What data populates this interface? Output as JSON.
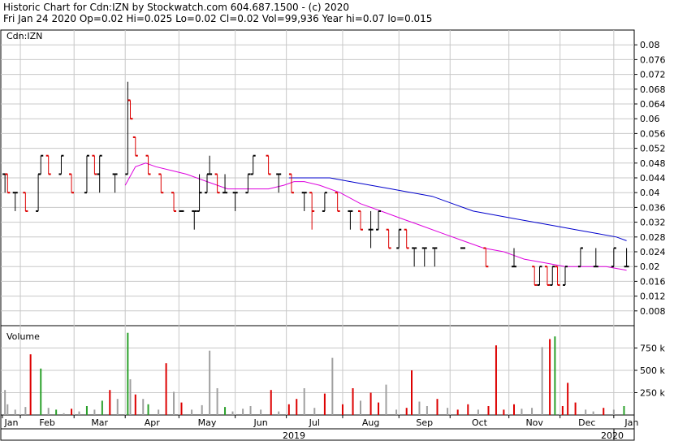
{
  "header": {
    "line1": "Historic Chart for Cdn:IZN by Stockwatch.com 604.687.1500 - (c) 2020",
    "line2": "Fri Jan 24 2020  Op=0.02  Hi=0.025  Lo=0.02  Cl=0.02  Vol=99,936  Year hi=0.07  lo=0.015"
  },
  "chart_data": {
    "type": "line",
    "symbol_label": "Cdn:IZN",
    "volume_label": "Volume",
    "price_ylim": [
      0.004,
      0.084
    ],
    "price_ticks": [
      "0.08",
      "0.076",
      "0.072",
      "0.068",
      "0.064",
      "0.06",
      "0.056",
      "0.052",
      "0.048",
      "0.044",
      "0.04",
      "0.036",
      "0.032",
      "0.028",
      "0.024",
      "0.02",
      "0.016",
      "0.012",
      "0.008"
    ],
    "volume_ylim": [
      0,
      1000000
    ],
    "volume_ticks": [
      {
        "label": "750 k",
        "value": 750000
      },
      {
        "label": "500 k",
        "value": 500000
      },
      {
        "label": "250 k",
        "value": 250000
      }
    ],
    "months": [
      {
        "label": "Jan",
        "day": 0
      },
      {
        "label": "Feb",
        "day": 7
      },
      {
        "label": "Mar",
        "day": 28
      },
      {
        "label": "Apr",
        "day": 48
      },
      {
        "label": "May",
        "day": 69
      },
      {
        "label": "Jun",
        "day": 91
      },
      {
        "label": "Jul",
        "day": 111
      },
      {
        "label": "Aug",
        "day": 133
      },
      {
        "label": "Sep",
        "day": 155
      },
      {
        "label": "Oct",
        "day": 175
      },
      {
        "label": "Nov",
        "day": 198
      },
      {
        "label": "Dec",
        "day": 218
      },
      {
        "label": "Jan",
        "day": 239
      }
    ],
    "years": [
      {
        "label": "2019"
      },
      {
        "label": "2020"
      }
    ],
    "colors": {
      "up": "#000000",
      "down": "#dd0000",
      "ma_short": "#dd00dd",
      "ma_long": "#0000cc",
      "vol_up": "#2aa02a",
      "vol_down": "#dd0000",
      "vol_neutral": "#a0a0a0",
      "grid": "#c8c8c8"
    },
    "ma_short": [
      [
        48,
        0.042
      ],
      [
        52,
        0.047
      ],
      [
        56,
        0.048
      ],
      [
        60,
        0.047
      ],
      [
        66,
        0.046
      ],
      [
        72,
        0.045
      ],
      [
        80,
        0.043
      ],
      [
        88,
        0.041
      ],
      [
        96,
        0.041
      ],
      [
        104,
        0.041
      ],
      [
        110,
        0.042
      ],
      [
        114,
        0.043
      ],
      [
        118,
        0.043
      ],
      [
        124,
        0.042
      ],
      [
        132,
        0.04
      ],
      [
        140,
        0.037
      ],
      [
        148,
        0.035
      ],
      [
        156,
        0.033
      ],
      [
        164,
        0.031
      ],
      [
        172,
        0.029
      ],
      [
        180,
        0.027
      ],
      [
        188,
        0.025
      ],
      [
        196,
        0.024
      ],
      [
        204,
        0.022
      ],
      [
        212,
        0.021
      ],
      [
        220,
        0.02
      ],
      [
        228,
        0.02
      ],
      [
        236,
        0.02
      ],
      [
        244,
        0.019
      ]
    ],
    "ma_long": [
      [
        112,
        0.044
      ],
      [
        120,
        0.044
      ],
      [
        128,
        0.044
      ],
      [
        136,
        0.043
      ],
      [
        144,
        0.042
      ],
      [
        152,
        0.041
      ],
      [
        160,
        0.04
      ],
      [
        168,
        0.039
      ],
      [
        176,
        0.037
      ],
      [
        184,
        0.035
      ],
      [
        192,
        0.034
      ],
      [
        200,
        0.033
      ],
      [
        208,
        0.032
      ],
      [
        216,
        0.031
      ],
      [
        224,
        0.03
      ],
      [
        232,
        0.029
      ],
      [
        240,
        0.028
      ],
      [
        244,
        0.027
      ]
    ],
    "ohlc": [
      {
        "d": 1,
        "o": 0.045,
        "h": 0.045,
        "l": 0.04,
        "c": 0.045
      },
      {
        "d": 2,
        "o": 0.045,
        "h": 0.045,
        "l": 0.04,
        "c": 0.04
      },
      {
        "d": 5,
        "o": 0.04,
        "h": 0.04,
        "l": 0.035,
        "c": 0.04
      },
      {
        "d": 9,
        "o": 0.04,
        "h": 0.04,
        "l": 0.035,
        "c": 0.035
      },
      {
        "d": 14,
        "o": 0.035,
        "h": 0.045,
        "l": 0.035,
        "c": 0.045
      },
      {
        "d": 15,
        "o": 0.045,
        "h": 0.05,
        "l": 0.045,
        "c": 0.05
      },
      {
        "d": 18,
        "o": 0.05,
        "h": 0.05,
        "l": 0.045,
        "c": 0.045
      },
      {
        "d": 23,
        "o": 0.045,
        "h": 0.05,
        "l": 0.045,
        "c": 0.05
      },
      {
        "d": 27,
        "o": 0.045,
        "h": 0.045,
        "l": 0.04,
        "c": 0.04
      },
      {
        "d": 33,
        "o": 0.04,
        "h": 0.05,
        "l": 0.04,
        "c": 0.05
      },
      {
        "d": 36,
        "o": 0.05,
        "h": 0.05,
        "l": 0.045,
        "c": 0.045
      },
      {
        "d": 38,
        "o": 0.045,
        "h": 0.05,
        "l": 0.04,
        "c": 0.05
      },
      {
        "d": 44,
        "o": 0.045,
        "h": 0.045,
        "l": 0.04,
        "c": 0.045
      },
      {
        "d": 49,
        "o": 0.045,
        "h": 0.07,
        "l": 0.045,
        "c": 0.065
      },
      {
        "d": 50,
        "o": 0.065,
        "h": 0.065,
        "l": 0.06,
        "c": 0.06
      },
      {
        "d": 52,
        "o": 0.055,
        "h": 0.055,
        "l": 0.05,
        "c": 0.05
      },
      {
        "d": 57,
        "o": 0.05,
        "h": 0.05,
        "l": 0.045,
        "c": 0.045
      },
      {
        "d": 62,
        "o": 0.045,
        "h": 0.045,
        "l": 0.04,
        "c": 0.04
      },
      {
        "d": 67,
        "o": 0.04,
        "h": 0.04,
        "l": 0.035,
        "c": 0.035
      },
      {
        "d": 70,
        "o": 0.035,
        "h": 0.035,
        "l": 0.035,
        "c": 0.035
      },
      {
        "d": 75,
        "o": 0.035,
        "h": 0.035,
        "l": 0.03,
        "c": 0.035
      },
      {
        "d": 77,
        "o": 0.035,
        "h": 0.045,
        "l": 0.035,
        "c": 0.04
      },
      {
        "d": 80,
        "o": 0.04,
        "h": 0.045,
        "l": 0.04,
        "c": 0.045
      },
      {
        "d": 81,
        "o": 0.045,
        "h": 0.05,
        "l": 0.045,
        "c": 0.045
      },
      {
        "d": 84,
        "o": 0.045,
        "h": 0.045,
        "l": 0.04,
        "c": 0.04
      },
      {
        "d": 87,
        "o": 0.04,
        "h": 0.045,
        "l": 0.04,
        "c": 0.04
      },
      {
        "d": 91,
        "o": 0.04,
        "h": 0.04,
        "l": 0.035,
        "c": 0.04
      },
      {
        "d": 96,
        "o": 0.04,
        "h": 0.045,
        "l": 0.04,
        "c": 0.045
      },
      {
        "d": 98,
        "o": 0.045,
        "h": 0.05,
        "l": 0.045,
        "c": 0.05
      },
      {
        "d": 104,
        "o": 0.05,
        "h": 0.05,
        "l": 0.045,
        "c": 0.045
      },
      {
        "d": 108,
        "o": 0.045,
        "h": 0.045,
        "l": 0.04,
        "c": 0.045
      },
      {
        "d": 113,
        "o": 0.045,
        "h": 0.045,
        "l": 0.04,
        "c": 0.04
      },
      {
        "d": 118,
        "o": 0.04,
        "h": 0.04,
        "l": 0.035,
        "c": 0.04
      },
      {
        "d": 121,
        "o": 0.04,
        "h": 0.04,
        "l": 0.03,
        "c": 0.035
      },
      {
        "d": 126,
        "o": 0.035,
        "h": 0.04,
        "l": 0.035,
        "c": 0.04
      },
      {
        "d": 131,
        "o": 0.04,
        "h": 0.04,
        "l": 0.035,
        "c": 0.035
      },
      {
        "d": 136,
        "o": 0.035,
        "h": 0.035,
        "l": 0.03,
        "c": 0.035
      },
      {
        "d": 140,
        "o": 0.035,
        "h": 0.035,
        "l": 0.03,
        "c": 0.03
      },
      {
        "d": 144,
        "o": 0.03,
        "h": 0.035,
        "l": 0.025,
        "c": 0.03
      },
      {
        "d": 147,
        "o": 0.03,
        "h": 0.035,
        "l": 0.03,
        "c": 0.035
      },
      {
        "d": 151,
        "o": 0.03,
        "h": 0.03,
        "l": 0.025,
        "c": 0.025
      },
      {
        "d": 155,
        "o": 0.025,
        "h": 0.03,
        "l": 0.025,
        "c": 0.03
      },
      {
        "d": 158,
        "o": 0.03,
        "h": 0.03,
        "l": 0.025,
        "c": 0.025
      },
      {
        "d": 161,
        "o": 0.025,
        "h": 0.025,
        "l": 0.02,
        "c": 0.025
      },
      {
        "d": 165,
        "o": 0.025,
        "h": 0.025,
        "l": 0.02,
        "c": 0.025
      },
      {
        "d": 169,
        "o": 0.025,
        "h": 0.025,
        "l": 0.02,
        "c": 0.025
      },
      {
        "d": 180,
        "o": 0.025,
        "h": 0.025,
        "l": 0.025,
        "c": 0.025
      },
      {
        "d": 189,
        "o": 0.025,
        "h": 0.025,
        "l": 0.02,
        "c": 0.02
      },
      {
        "d": 200,
        "o": 0.02,
        "h": 0.025,
        "l": 0.02,
        "c": 0.02
      },
      {
        "d": 208,
        "o": 0.02,
        "h": 0.02,
        "l": 0.015,
        "c": 0.015
      },
      {
        "d": 210,
        "o": 0.015,
        "h": 0.02,
        "l": 0.015,
        "c": 0.02
      },
      {
        "d": 213,
        "o": 0.02,
        "h": 0.02,
        "l": 0.015,
        "c": 0.015
      },
      {
        "d": 215,
        "o": 0.015,
        "h": 0.02,
        "l": 0.015,
        "c": 0.02
      },
      {
        "d": 217,
        "o": 0.02,
        "h": 0.02,
        "l": 0.015,
        "c": 0.015
      },
      {
        "d": 220,
        "o": 0.015,
        "h": 0.02,
        "l": 0.015,
        "c": 0.02
      },
      {
        "d": 226,
        "o": 0.02,
        "h": 0.025,
        "l": 0.02,
        "c": 0.025
      },
      {
        "d": 232,
        "o": 0.02,
        "h": 0.025,
        "l": 0.02,
        "c": 0.02
      },
      {
        "d": 239,
        "o": 0.02,
        "h": 0.025,
        "l": 0.02,
        "c": 0.025
      },
      {
        "d": 244,
        "o": 0.02,
        "h": 0.025,
        "l": 0.02,
        "c": 0.02
      }
    ],
    "volume": [
      {
        "d": 1,
        "v": 280000,
        "c": "n"
      },
      {
        "d": 2,
        "v": 120000,
        "c": "n"
      },
      {
        "d": 5,
        "v": 60000,
        "c": "n"
      },
      {
        "d": 9,
        "v": 90000,
        "c": "n"
      },
      {
        "d": 11,
        "v": 680000,
        "c": "r"
      },
      {
        "d": 15,
        "v": 520000,
        "c": "g"
      },
      {
        "d": 18,
        "v": 80000,
        "c": "n"
      },
      {
        "d": 21,
        "v": 60000,
        "c": "g"
      },
      {
        "d": 24,
        "v": 20000,
        "c": "n"
      },
      {
        "d": 27,
        "v": 70000,
        "c": "r"
      },
      {
        "d": 30,
        "v": 40000,
        "c": "n"
      },
      {
        "d": 33,
        "v": 100000,
        "c": "g"
      },
      {
        "d": 36,
        "v": 60000,
        "c": "n"
      },
      {
        "d": 39,
        "v": 160000,
        "c": "g"
      },
      {
        "d": 42,
        "v": 280000,
        "c": "r"
      },
      {
        "d": 45,
        "v": 180000,
        "c": "n"
      },
      {
        "d": 49,
        "v": 920000,
        "c": "g"
      },
      {
        "d": 50,
        "v": 400000,
        "c": "n"
      },
      {
        "d": 52,
        "v": 230000,
        "c": "r"
      },
      {
        "d": 55,
        "v": 180000,
        "c": "n"
      },
      {
        "d": 57,
        "v": 120000,
        "c": "g"
      },
      {
        "d": 61,
        "v": 60000,
        "c": "n"
      },
      {
        "d": 64,
        "v": 580000,
        "c": "r"
      },
      {
        "d": 67,
        "v": 260000,
        "c": "n"
      },
      {
        "d": 70,
        "v": 140000,
        "c": "r"
      },
      {
        "d": 74,
        "v": 60000,
        "c": "n"
      },
      {
        "d": 78,
        "v": 110000,
        "c": "n"
      },
      {
        "d": 81,
        "v": 720000,
        "c": "n"
      },
      {
        "d": 84,
        "v": 300000,
        "c": "n"
      },
      {
        "d": 87,
        "v": 90000,
        "c": "g"
      },
      {
        "d": 90,
        "v": 40000,
        "c": "n"
      },
      {
        "d": 94,
        "v": 70000,
        "c": "n"
      },
      {
        "d": 97,
        "v": 100000,
        "c": "n"
      },
      {
        "d": 101,
        "v": 60000,
        "c": "n"
      },
      {
        "d": 105,
        "v": 280000,
        "c": "r"
      },
      {
        "d": 108,
        "v": 40000,
        "c": "n"
      },
      {
        "d": 112,
        "v": 120000,
        "c": "r"
      },
      {
        "d": 115,
        "v": 180000,
        "c": "r"
      },
      {
        "d": 118,
        "v": 300000,
        "c": "n"
      },
      {
        "d": 122,
        "v": 80000,
        "c": "n"
      },
      {
        "d": 126,
        "v": 240000,
        "c": "r"
      },
      {
        "d": 129,
        "v": 640000,
        "c": "n"
      },
      {
        "d": 133,
        "v": 120000,
        "c": "r"
      },
      {
        "d": 137,
        "v": 300000,
        "c": "r"
      },
      {
        "d": 140,
        "v": 160000,
        "c": "n"
      },
      {
        "d": 144,
        "v": 250000,
        "c": "r"
      },
      {
        "d": 147,
        "v": 140000,
        "c": "r"
      },
      {
        "d": 150,
        "v": 340000,
        "c": "n"
      },
      {
        "d": 154,
        "v": 60000,
        "c": "n"
      },
      {
        "d": 158,
        "v": 80000,
        "c": "r"
      },
      {
        "d": 160,
        "v": 500000,
        "c": "r"
      },
      {
        "d": 163,
        "v": 150000,
        "c": "n"
      },
      {
        "d": 166,
        "v": 100000,
        "c": "n"
      },
      {
        "d": 170,
        "v": 180000,
        "c": "r"
      },
      {
        "d": 174,
        "v": 80000,
        "c": "n"
      },
      {
        "d": 178,
        "v": 60000,
        "c": "r"
      },
      {
        "d": 182,
        "v": 120000,
        "c": "r"
      },
      {
        "d": 186,
        "v": 60000,
        "c": "n"
      },
      {
        "d": 190,
        "v": 100000,
        "c": "r"
      },
      {
        "d": 193,
        "v": 780000,
        "c": "r"
      },
      {
        "d": 196,
        "v": 60000,
        "c": "r"
      },
      {
        "d": 200,
        "v": 120000,
        "c": "r"
      },
      {
        "d": 203,
        "v": 70000,
        "c": "n"
      },
      {
        "d": 207,
        "v": 80000,
        "c": "n"
      },
      {
        "d": 211,
        "v": 760000,
        "c": "n"
      },
      {
        "d": 214,
        "v": 850000,
        "c": "r"
      },
      {
        "d": 216,
        "v": 880000,
        "c": "g"
      },
      {
        "d": 219,
        "v": 100000,
        "c": "r"
      },
      {
        "d": 221,
        "v": 360000,
        "c": "r"
      },
      {
        "d": 224,
        "v": 140000,
        "c": "r"
      },
      {
        "d": 228,
        "v": 60000,
        "c": "n"
      },
      {
        "d": 231,
        "v": 40000,
        "c": "n"
      },
      {
        "d": 235,
        "v": 80000,
        "c": "r"
      },
      {
        "d": 239,
        "v": 60000,
        "c": "n"
      },
      {
        "d": 243,
        "v": 100000,
        "c": "g"
      }
    ]
  }
}
